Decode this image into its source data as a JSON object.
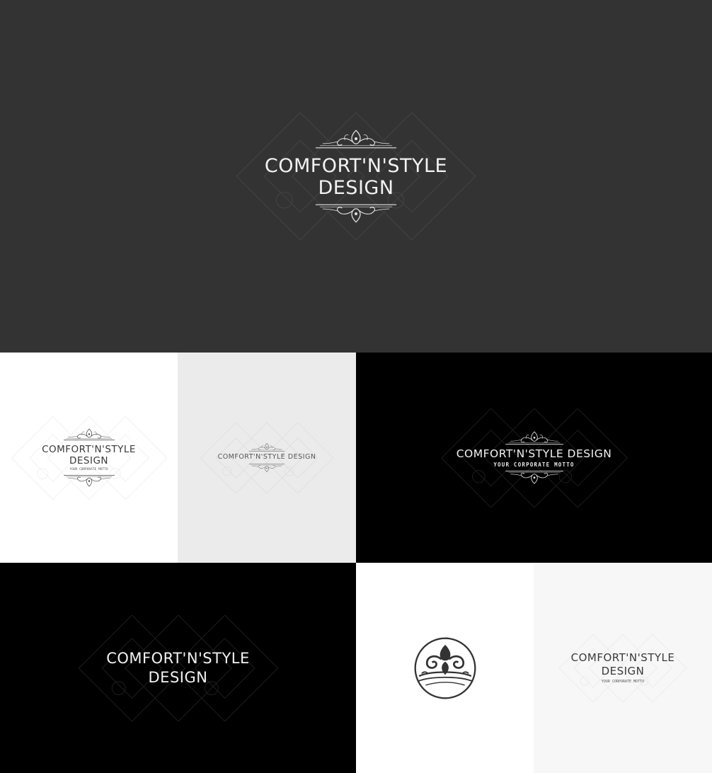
{
  "brand": {
    "line1": "COMFORT'N'STYLE",
    "line2": "DESIGN",
    "single_line": "COMFORT'N'STYLE DESIGN",
    "motto": "YOUR CORPORATE MOTTO"
  },
  "colors": {
    "hero_bg": "#333333",
    "white_bg": "#ffffff",
    "light_gray_bg": "#ebebeb",
    "black_bg": "#000000",
    "off_white_bg": "#f7f7f7"
  },
  "icons": [
    "ornament-top-icon",
    "ornament-bottom-icon",
    "fleur-crown-emblem-icon",
    "watermark-pattern-icon"
  ]
}
